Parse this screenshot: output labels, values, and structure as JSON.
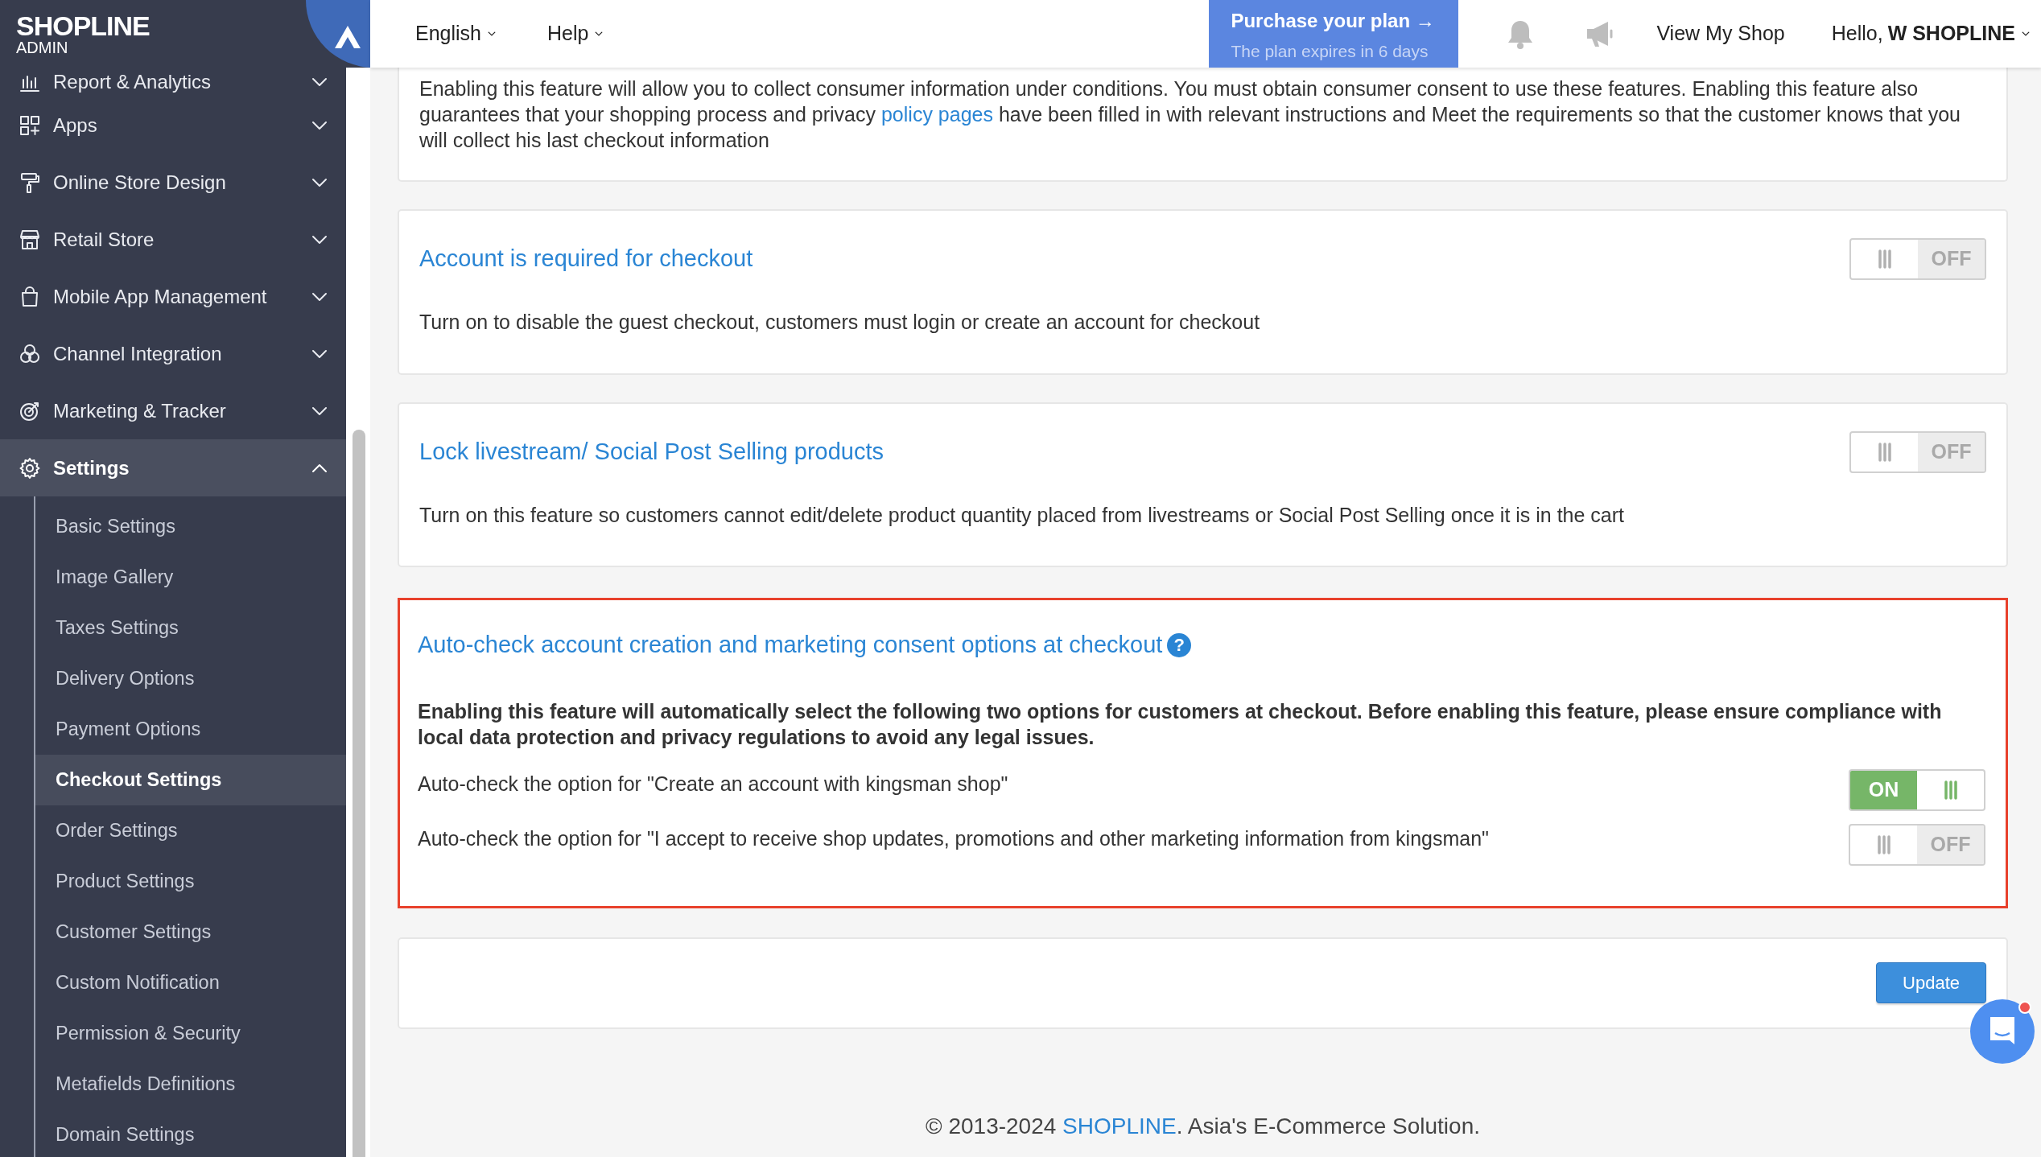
{
  "brand": {
    "name": "SHOPLINE",
    "sub": "ADMIN"
  },
  "header": {
    "menus": [
      {
        "label": "English"
      },
      {
        "label": "Help"
      }
    ],
    "promo": {
      "title": "Purchase your plan →",
      "subtitle": "The plan expires in 6 days"
    },
    "view_shop": "View My Shop",
    "greeting": "Hello,",
    "user": "W SHOPLINE"
  },
  "sidebar": {
    "items": [
      {
        "label": "Report & Analytics",
        "expanded": false
      },
      {
        "label": "Apps",
        "expanded": false
      },
      {
        "label": "Online Store Design",
        "expanded": false
      },
      {
        "label": "Retail Store",
        "expanded": false
      },
      {
        "label": "Mobile App Management",
        "expanded": false
      },
      {
        "label": "Channel Integration",
        "expanded": false
      },
      {
        "label": "Marketing & Tracker",
        "expanded": false
      },
      {
        "label": "Settings",
        "expanded": true,
        "children": [
          {
            "label": "Basic Settings",
            "selected": false
          },
          {
            "label": "Image Gallery",
            "selected": false
          },
          {
            "label": "Taxes Settings",
            "selected": false
          },
          {
            "label": "Delivery Options",
            "selected": false
          },
          {
            "label": "Payment Options",
            "selected": false
          },
          {
            "label": "Checkout Settings",
            "selected": true
          },
          {
            "label": "Order Settings",
            "selected": false
          },
          {
            "label": "Product Settings",
            "selected": false
          },
          {
            "label": "Customer Settings",
            "selected": false
          },
          {
            "label": "Custom Notification",
            "selected": false
          },
          {
            "label": "Permission & Security",
            "selected": false
          },
          {
            "label": "Metafields Definitions",
            "selected": false
          },
          {
            "label": "Domain Settings",
            "selected": false
          }
        ]
      }
    ]
  },
  "intro": {
    "before": "Enabling this feature will allow you to collect consumer information under conditions. You must obtain consumer consent to use these features. Enabling this feature also guarantees that your shopping process and privacy ",
    "link": "policy pages",
    "after": " have been filled in with relevant instructions and Meet the requirements so that the customer knows that you will collect his last checkout information"
  },
  "settings": [
    {
      "title": "Account is required for checkout",
      "description": "Turn on to disable the guest checkout, customers must login or create an account for checkout",
      "on": false,
      "toggle_label": "OFF"
    },
    {
      "title": "Lock livestream/ Social Post Selling products",
      "description": "Turn on this feature so customers cannot edit/delete product quantity placed from livestreams or Social Post Selling once it is in the cart",
      "on": false,
      "toggle_label": "OFF"
    }
  ],
  "auto_check": {
    "title": "Auto-check account creation and marketing consent options at checkout",
    "help": "?",
    "description": "Enabling this feature will automatically select the following two options for customers at checkout. Before enabling this feature, please ensure compliance with local data protection and privacy regulations to avoid any legal issues.",
    "options": [
      {
        "label": "Auto-check the option for \"Create an account with kingsman shop\"",
        "on": true,
        "toggle_label": "ON"
      },
      {
        "label": "Auto-check the option for \"I accept to receive shop updates, promotions and other marketing information from kingsman\"",
        "on": false,
        "toggle_label": "OFF"
      }
    ]
  },
  "update_button": "Update",
  "footer": {
    "before": "© 2013-2024 ",
    "link": "SHOPLINE",
    "after": ". Asia's E-Commerce Solution."
  }
}
